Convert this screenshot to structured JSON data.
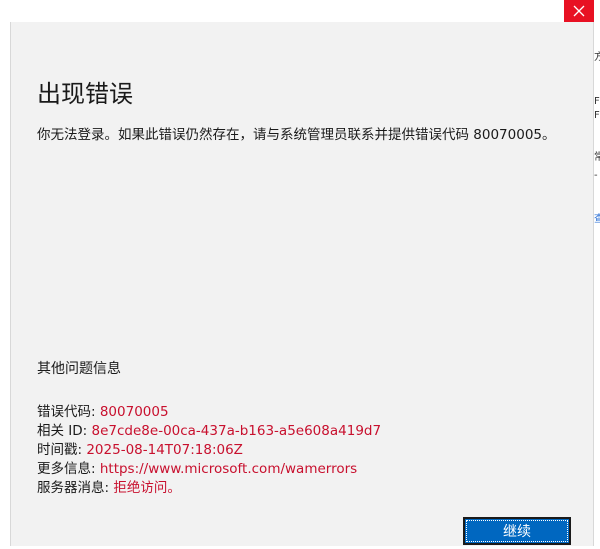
{
  "window": {
    "close_icon": "close-icon"
  },
  "error": {
    "title": "出现错误",
    "message": "你无法登录。如果此错误仍然存在，请与系统管理员联系并提供错误代码 80070005。"
  },
  "more_info": {
    "heading": "其他问题信息",
    "rows": [
      {
        "label": "错误代码: ",
        "value": "80070005"
      },
      {
        "label": "相关 ID: ",
        "value": "8e7cde8e-00ca-437a-b163-a5e608a419d7"
      },
      {
        "label": "时间戳: ",
        "value": "2025-08-14T07:18:06Z"
      },
      {
        "label": "更多信息: ",
        "value": "https://www.microsoft.com/wamerrors"
      },
      {
        "label": "服务器消息: ",
        "value": "拒绝访问。"
      }
    ]
  },
  "actions": {
    "continue_label": "继续"
  },
  "background_fragments": {
    "f1": "方",
    "f2": "F",
    "f3": "F",
    "f4": "常",
    "f5": "-",
    "f6": "查"
  },
  "colors": {
    "accent": "#0067c0",
    "error_value": "#c8102e",
    "close_hover": "#e81123"
  }
}
